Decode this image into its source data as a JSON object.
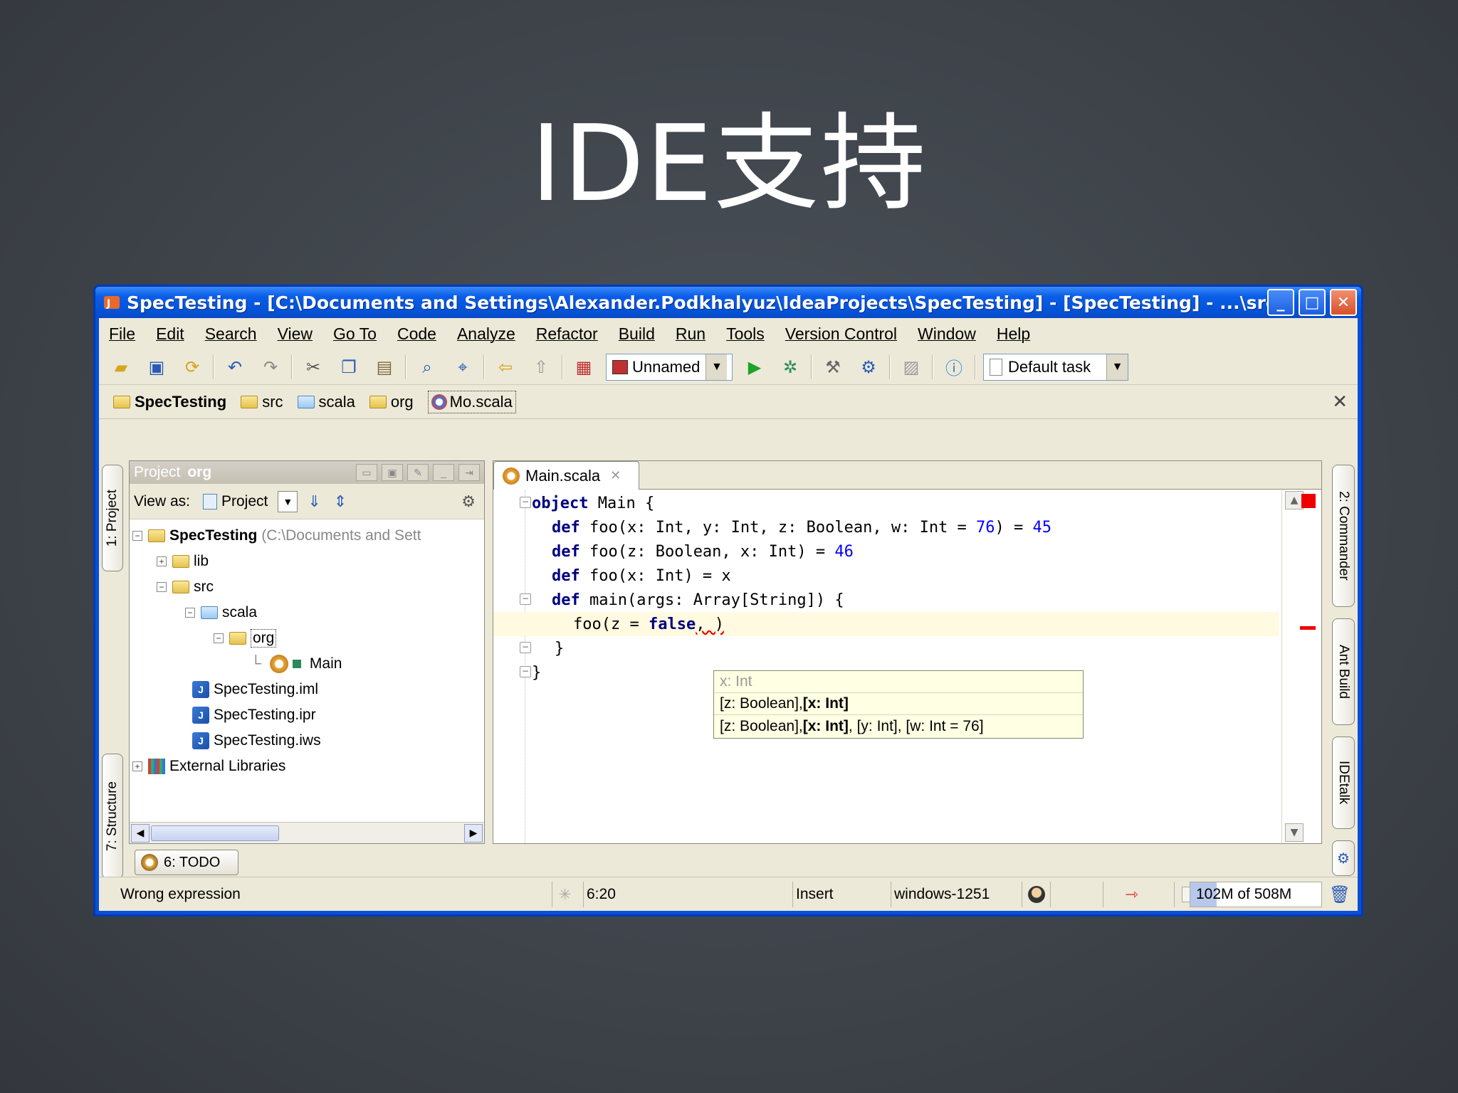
{
  "slide": {
    "title": "IDE支持"
  },
  "window": {
    "title": "SpecTesting - [C:\\Documents and Settings\\Alexander.Podkhalyuz\\IdeaProjects\\SpecTesting] - [SpecTesting] - ...\\src\\scala\\org...",
    "minimize": "_",
    "maximize": "□",
    "close": "✕"
  },
  "menu": [
    "File",
    "Edit",
    "Search",
    "View",
    "Go To",
    "Code",
    "Analyze",
    "Refactor",
    "Build",
    "Run",
    "Tools",
    "Version Control",
    "Window",
    "Help"
  ],
  "toolbar": {
    "run_config": "Unnamed",
    "task": "Default task"
  },
  "navbar": {
    "crumbs": [
      "SpecTesting",
      "src",
      "scala",
      "org",
      "Mo.scala"
    ]
  },
  "left_tabs": {
    "project": "1: Project",
    "structure": "7: Structure"
  },
  "right_tabs": {
    "commander": "2: Commander",
    "ant": "Ant Build",
    "idetalk": "IDEtalk"
  },
  "project_panel": {
    "header_prefix": "Project",
    "header_scope": "org",
    "view_as_label": "View as:",
    "view_as_value": "Project",
    "tree": [
      {
        "name": "SpecTesting",
        "hint": "(C:\\Documents and Sett"
      },
      {
        "name": "lib"
      },
      {
        "name": "src"
      },
      {
        "name": "scala"
      },
      {
        "name": "org"
      },
      {
        "name": "Main"
      },
      {
        "name": "SpecTesting.iml"
      },
      {
        "name": "SpecTesting.ipr"
      },
      {
        "name": "SpecTesting.iws"
      },
      {
        "name": "External Libraries"
      }
    ]
  },
  "editor": {
    "tab": "Main.scala",
    "lines": {
      "l1_kw": "object",
      "l1_rest": " Main {",
      "l2_kw": "def",
      "l2_rest": " foo(x: Int, y: Int, z: Boolean, w: Int = ",
      "l2_n1": "76",
      "l2_mid": ") = ",
      "l2_n2": "45",
      "l3_kw": "def",
      "l3_rest": " foo(z: Boolean, x: Int) = ",
      "l3_n": "46",
      "l4_kw": "def",
      "l4_rest": " foo(x: Int) = x",
      "l5_kw": "def",
      "l5_rest": " main(args: Array[String]) {",
      "l6_pre": "foo(z = ",
      "l6_kw": "false",
      "l6_post": ", )",
      "l7": "}",
      "l8": "}"
    },
    "popup": {
      "hint": "x: Int",
      "row1_a": "[z: Boolean],  ",
      "row1_b": "[x: Int]",
      "row2_a": "[z: Boolean],  ",
      "row2_b": "[x: Int]",
      "row2_c": " , [y: Int], [w: Int = 76]"
    }
  },
  "bottom": {
    "todo": "6: TODO",
    "status_message": "Wrong expression",
    "position": "6:20",
    "mode": "Insert",
    "encoding": "windows-1251",
    "memory": "102M of 508M",
    "memory_used_fraction": 0.2
  }
}
